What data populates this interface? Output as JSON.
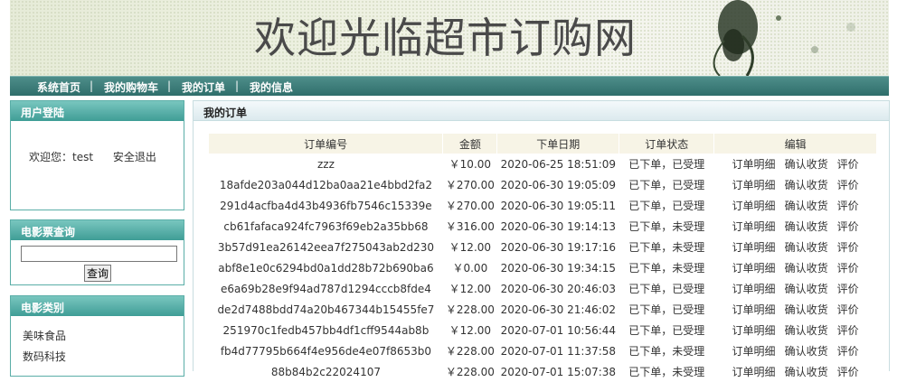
{
  "header": {
    "title": "欢迎光临超市订购网"
  },
  "nav": {
    "items": [
      "系统首页",
      "我的购物车",
      "我的订单",
      "我的信息"
    ]
  },
  "login_box": {
    "title": "用户登陆",
    "welcome": "欢迎您：test",
    "logout": "安全退出"
  },
  "movie_search": {
    "title": "电影票查询",
    "input_value": "",
    "button": "查询"
  },
  "category_box": {
    "title": "电影类别",
    "items": [
      "美味食品",
      "数码科技"
    ]
  },
  "main": {
    "title": "我的订单",
    "columns": [
      "订单编号",
      "金额",
      "下单日期",
      "订单状态",
      "编辑"
    ],
    "actions": [
      "订单明细",
      "确认收货",
      "评价"
    ],
    "rows": [
      {
        "id": "zzz",
        "amount": "￥10.00",
        "date": "2020-06-25 18:51:09",
        "status": "已下单，已受理"
      },
      {
        "id": "18afde203a044d12ba0aa21e4bbd2fa2",
        "amount": "￥270.00",
        "date": "2020-06-30 19:05:09",
        "status": "已下单，已受理"
      },
      {
        "id": "291d4acfba4d43b4936fb7546c15339e",
        "amount": "￥270.00",
        "date": "2020-06-30 19:05:11",
        "status": "已下单，已受理"
      },
      {
        "id": "cb61fafaca924fc7963f69eb2a35bb68",
        "amount": "￥316.00",
        "date": "2020-06-30 19:14:13",
        "status": "已下单，未受理"
      },
      {
        "id": "3b57d91ea26142eea7f275043ab2d230",
        "amount": "￥12.00",
        "date": "2020-06-30 19:17:16",
        "status": "已下单，未受理"
      },
      {
        "id": "abf8e1e0c6294bd0a1dd28b72b690ba6",
        "amount": "￥0.00",
        "date": "2020-06-30 19:34:15",
        "status": "已下单，未受理"
      },
      {
        "id": "e6a69b28e9f94ad787d1294cccb8fde4",
        "amount": "￥12.00",
        "date": "2020-06-30 20:46:03",
        "status": "已下单，已受理"
      },
      {
        "id": "de2d7488bdd74a20b467344b15455fe7",
        "amount": "￥228.00",
        "date": "2020-06-30 21:46:02",
        "status": "已下单，已受理"
      },
      {
        "id": "251970c1fedb457bb4df1cff9544ab8b",
        "amount": "￥12.00",
        "date": "2020-07-01 10:56:44",
        "status": "已下单，已受理"
      },
      {
        "id": "fb4d77795b664f4e956de4e07f8653b0",
        "amount": "￥228.00",
        "date": "2020-07-01 11:37:58",
        "status": "已下单，未受理"
      },
      {
        "id": "88b84b2c22024107",
        "amount": "￥228.00",
        "date": "2020-07-01 15:07:38",
        "status": "已下单，未受理"
      }
    ]
  },
  "colors": {
    "nav": "#2f6e6b",
    "side_head": "#3f9d96",
    "table_head": "#f7f4e6"
  }
}
